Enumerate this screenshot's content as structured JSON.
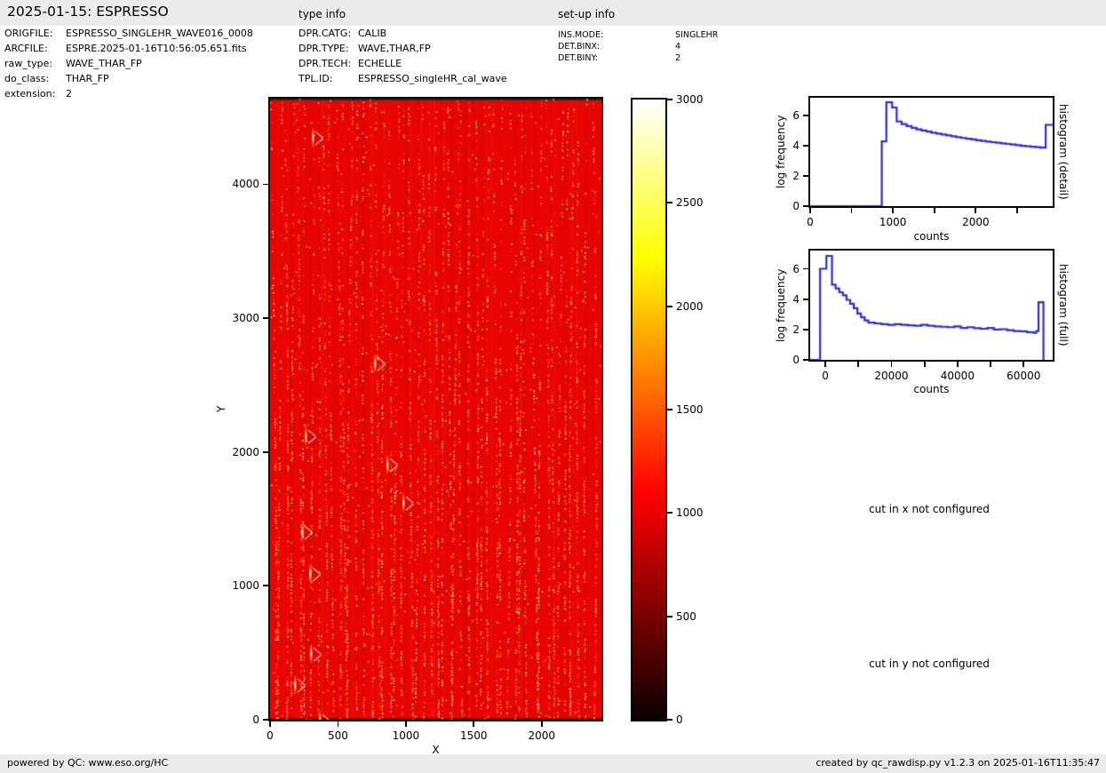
{
  "page": {
    "title": "2025-01-15: ESPRESSO",
    "panel_gray": "#ebebeb",
    "histogram_line_color": "#2d2dd6",
    "frame_red": "#e80400"
  },
  "header": {
    "title": "2025-01-15: ESPRESSO",
    "type_info_label": "type info",
    "setup_info_label": "set-up info",
    "file_info": [
      {
        "label": "ORIGFILE:",
        "value": "ESPRESSO_SINGLEHR_WAVE016_0008"
      },
      {
        "label": "ARCFILE:",
        "value": "ESPRE.2025-01-16T10:56:05.651.fits"
      },
      {
        "label": "raw_type:",
        "value": "WAVE_THAR_FP"
      },
      {
        "label": "do_class:",
        "value": "THAR_FP"
      },
      {
        "label": "extension:",
        "value": "2"
      }
    ],
    "type_info": [
      {
        "label": "DPR.CATG:",
        "value": "CALIB"
      },
      {
        "label": "DPR.TYPE:",
        "value": "WAVE,THAR,FP"
      },
      {
        "label": "DPR.TECH:",
        "value": "ECHELLE"
      },
      {
        "label": "TPL.ID:",
        "value": "ESPRESSO_singleHR_cal_wave"
      }
    ],
    "setup_info": [
      {
        "label": "INS.MODE:",
        "value": "SINGLEHR"
      },
      {
        "label": "DET.BINX:",
        "value": "4"
      },
      {
        "label": "DET.BINY:",
        "value": "2"
      }
    ]
  },
  "annotations": {
    "cut_x": "cut in x not configured",
    "cut_y": "cut in y not configured"
  },
  "footer": {
    "left": "powered by QC: www.eso.org/HC",
    "right": "created by qc_rawdisp.py v1.2.3 on 2025-01-16T11:35:47"
  },
  "chart_data": [
    {
      "id": "raw-frame",
      "type": "heatmap",
      "description": "ESPRESSO raw WAVE,THAR,FP echelle frame near bias level: red field with vertical dashed emission-dot order traces (ThAr lines and Fabry-Perot dots), brighter/denser toward bottom and right",
      "xlabel": "X",
      "ylabel": "Y",
      "xlim": [
        0,
        2440
      ],
      "ylim": [
        0,
        4640
      ],
      "xticks": [
        {
          "v": 0,
          "label": "0"
        },
        {
          "v": 500,
          "label": "500"
        },
        {
          "v": 1000,
          "label": "1000"
        },
        {
          "v": 1500,
          "label": "1500"
        },
        {
          "v": 2000,
          "label": "2000"
        }
      ],
      "yticks": [
        {
          "v": 0,
          "label": "0"
        },
        {
          "v": 1000,
          "label": "1000"
        },
        {
          "v": 2000,
          "label": "2000"
        },
        {
          "v": 3000,
          "label": "3000"
        },
        {
          "v": 4000,
          "label": "4000"
        }
      ],
      "colormap": "hot",
      "colorbar": {
        "min": 0,
        "max": 3000,
        "ticks": [
          {
            "v": 0,
            "label": "0"
          },
          {
            "v": 500,
            "label": "500"
          },
          {
            "v": 1000,
            "label": "1000"
          },
          {
            "v": 1500,
            "label": "1500"
          },
          {
            "v": 2000,
            "label": "2000"
          },
          {
            "v": 2500,
            "label": "2500"
          },
          {
            "v": 3000,
            "label": "3000"
          }
        ],
        "gradient_stops": [
          {
            "pos": 0,
            "color": "#0a0000"
          },
          {
            "pos": 0.365,
            "color": "#ff0000"
          },
          {
            "pos": 0.746,
            "color": "#ffff00"
          },
          {
            "pos": 1,
            "color": "#ffffff"
          }
        ]
      }
    },
    {
      "id": "histogram-detail",
      "type": "line",
      "right_label": "histogram (detail)",
      "xlabel": "counts",
      "ylabel": "log frequency",
      "xlim": [
        0,
        2930
      ],
      "ylim": [
        0,
        7.2
      ],
      "xticks": [
        {
          "v": 0,
          "label": "0"
        },
        {
          "v": 500,
          "label": ""
        },
        {
          "v": 1000,
          "label": "1000"
        },
        {
          "v": 1500,
          "label": ""
        },
        {
          "v": 2000,
          "label": "2000"
        },
        {
          "v": 2500,
          "label": ""
        }
      ],
      "yticks": [
        {
          "v": 0,
          "label": "0"
        },
        {
          "v": 2,
          "label": "2"
        },
        {
          "v": 4,
          "label": "4"
        },
        {
          "v": 6,
          "label": "6"
        }
      ],
      "line_color": "#2d2dd6",
      "path": [
        [
          0,
          0
        ],
        [
          865,
          0
        ],
        [
          865,
          4.3
        ],
        [
          920,
          4.3
        ],
        [
          920,
          6.9
        ],
        [
          990,
          6.9
        ],
        [
          990,
          6.55
        ],
        [
          1045,
          6.55
        ],
        [
          1045,
          5.62
        ],
        [
          1105,
          5.62
        ],
        [
          1105,
          5.45
        ],
        [
          1165,
          5.45
        ],
        [
          1165,
          5.32
        ],
        [
          1225,
          5.32
        ],
        [
          1225,
          5.2
        ],
        [
          1285,
          5.2
        ],
        [
          1285,
          5.1
        ],
        [
          1345,
          5.1
        ],
        [
          1345,
          5.02
        ],
        [
          1405,
          5.02
        ],
        [
          1405,
          4.95
        ],
        [
          1465,
          4.95
        ],
        [
          1465,
          4.88
        ],
        [
          1525,
          4.88
        ],
        [
          1525,
          4.82
        ],
        [
          1585,
          4.82
        ],
        [
          1585,
          4.76
        ],
        [
          1645,
          4.76
        ],
        [
          1645,
          4.7
        ],
        [
          1705,
          4.7
        ],
        [
          1705,
          4.64
        ],
        [
          1765,
          4.64
        ],
        [
          1765,
          4.58
        ],
        [
          1825,
          4.58
        ],
        [
          1825,
          4.53
        ],
        [
          1885,
          4.53
        ],
        [
          1885,
          4.48
        ],
        [
          1945,
          4.48
        ],
        [
          1945,
          4.43
        ],
        [
          2005,
          4.43
        ],
        [
          2005,
          4.38
        ],
        [
          2065,
          4.38
        ],
        [
          2065,
          4.33
        ],
        [
          2125,
          4.33
        ],
        [
          2125,
          4.29
        ],
        [
          2185,
          4.29
        ],
        [
          2185,
          4.25
        ],
        [
          2245,
          4.25
        ],
        [
          2245,
          4.21
        ],
        [
          2305,
          4.21
        ],
        [
          2305,
          4.17
        ],
        [
          2365,
          4.17
        ],
        [
          2365,
          4.13
        ],
        [
          2425,
          4.13
        ],
        [
          2425,
          4.09
        ],
        [
          2485,
          4.09
        ],
        [
          2485,
          4.05
        ],
        [
          2545,
          4.05
        ],
        [
          2545,
          4.01
        ],
        [
          2605,
          4.01
        ],
        [
          2605,
          3.98
        ],
        [
          2665,
          3.98
        ],
        [
          2665,
          3.95
        ],
        [
          2725,
          3.95
        ],
        [
          2725,
          3.92
        ],
        [
          2785,
          3.92
        ],
        [
          2785,
          3.89
        ],
        [
          2845,
          3.89
        ],
        [
          2845,
          5.4
        ],
        [
          2930,
          5.4
        ]
      ]
    },
    {
      "id": "histogram-full",
      "type": "line",
      "right_label": "histogram (full)",
      "xlabel": "counts",
      "ylabel": "log frequency",
      "xlim": [
        -4600,
        68800
      ],
      "ylim": [
        0,
        7.2
      ],
      "xticks": [
        {
          "v": 0,
          "label": "0"
        },
        {
          "v": 10000,
          "label": ""
        },
        {
          "v": 20000,
          "label": "20000"
        },
        {
          "v": 30000,
          "label": ""
        },
        {
          "v": 40000,
          "label": "40000"
        },
        {
          "v": 50000,
          "label": ""
        },
        {
          "v": 60000,
          "label": "60000"
        }
      ],
      "yticks": [
        {
          "v": 0,
          "label": "0"
        },
        {
          "v": 2,
          "label": "2"
        },
        {
          "v": 4,
          "label": "4"
        },
        {
          "v": 6,
          "label": "6"
        }
      ],
      "line_color": "#2d2dd6",
      "path": [
        [
          -4600,
          0
        ],
        [
          -1600,
          0
        ],
        [
          -1600,
          6.0
        ],
        [
          300,
          6.0
        ],
        [
          300,
          6.85
        ],
        [
          2000,
          6.85
        ],
        [
          2000,
          4.95
        ],
        [
          3100,
          4.95
        ],
        [
          3100,
          4.7
        ],
        [
          4200,
          4.7
        ],
        [
          4200,
          4.45
        ],
        [
          5300,
          4.45
        ],
        [
          5300,
          4.25
        ],
        [
          6400,
          4.25
        ],
        [
          6400,
          3.95
        ],
        [
          7500,
          3.95
        ],
        [
          7500,
          3.7
        ],
        [
          8600,
          3.7
        ],
        [
          8600,
          3.4
        ],
        [
          9700,
          3.4
        ],
        [
          9700,
          3.05
        ],
        [
          10800,
          3.05
        ],
        [
          10800,
          2.8
        ],
        [
          11900,
          2.8
        ],
        [
          11900,
          2.6
        ],
        [
          13000,
          2.6
        ],
        [
          13000,
          2.45
        ],
        [
          15000,
          2.45
        ],
        [
          15000,
          2.4
        ],
        [
          17000,
          2.4
        ],
        [
          17000,
          2.35
        ],
        [
          19000,
          2.35
        ],
        [
          19000,
          2.3
        ],
        [
          21000,
          2.3
        ],
        [
          21000,
          2.35
        ],
        [
          23000,
          2.35
        ],
        [
          23000,
          2.3
        ],
        [
          25000,
          2.3
        ],
        [
          25000,
          2.28
        ],
        [
          27000,
          2.28
        ],
        [
          27000,
          2.25
        ],
        [
          29000,
          2.25
        ],
        [
          29000,
          2.3
        ],
        [
          31000,
          2.3
        ],
        [
          31000,
          2.25
        ],
        [
          33000,
          2.25
        ],
        [
          33000,
          2.2
        ],
        [
          35000,
          2.2
        ],
        [
          35000,
          2.18
        ],
        [
          37000,
          2.18
        ],
        [
          37000,
          2.15
        ],
        [
          39000,
          2.15
        ],
        [
          39000,
          2.2
        ],
        [
          41000,
          2.2
        ],
        [
          41000,
          2.1
        ],
        [
          43000,
          2.1
        ],
        [
          43000,
          2.15
        ],
        [
          45000,
          2.15
        ],
        [
          45000,
          2.08
        ],
        [
          47000,
          2.08
        ],
        [
          47000,
          2.05
        ],
        [
          49000,
          2.05
        ],
        [
          49000,
          2.1
        ],
        [
          51000,
          2.1
        ],
        [
          51000,
          2.0
        ],
        [
          53000,
          2.0
        ],
        [
          53000,
          2.02
        ],
        [
          55000,
          2.02
        ],
        [
          55000,
          1.95
        ],
        [
          57000,
          1.95
        ],
        [
          57000,
          1.9
        ],
        [
          59000,
          1.9
        ],
        [
          59000,
          1.88
        ],
        [
          61000,
          1.88
        ],
        [
          61000,
          1.82
        ],
        [
          63000,
          1.82
        ],
        [
          63000,
          1.78
        ],
        [
          63800,
          1.78
        ],
        [
          63800,
          1.9
        ],
        [
          64500,
          1.9
        ],
        [
          64500,
          3.8
        ],
        [
          66000,
          3.8
        ],
        [
          66000,
          0
        ]
      ]
    }
  ]
}
